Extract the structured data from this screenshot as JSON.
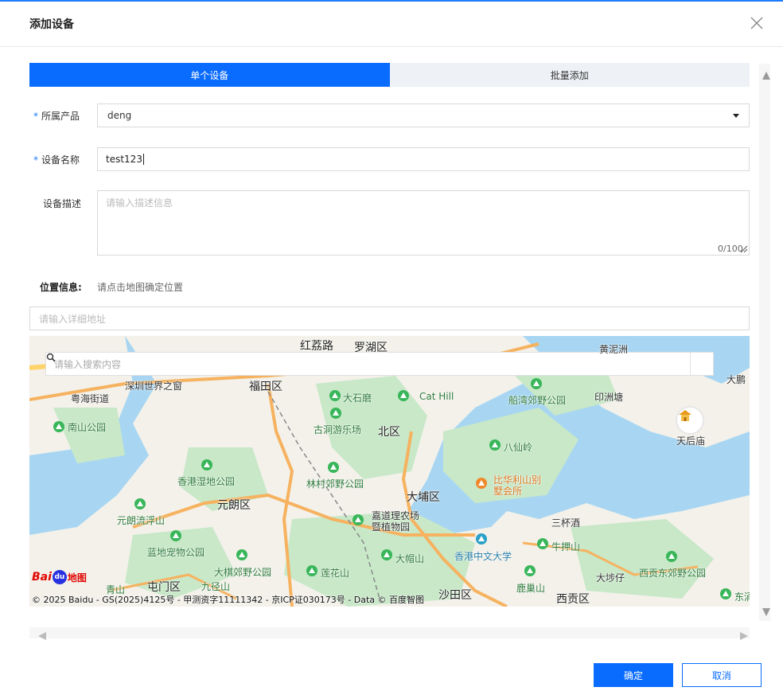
{
  "dialog": {
    "title": "添加设备",
    "close_icon": "close-icon"
  },
  "tabs": [
    {
      "label": "单个设备",
      "active": true
    },
    {
      "label": "批量添加",
      "active": false
    }
  ],
  "form": {
    "product": {
      "label": "所属产品",
      "required_mark": "*",
      "value": "deng"
    },
    "device_name": {
      "label": "设备名称",
      "required_mark": "*",
      "value": "test123"
    },
    "description": {
      "label": "设备描述",
      "placeholder": "请输入描述信息",
      "counter": "0/100"
    },
    "location": {
      "label": "位置信息:",
      "hint": "请点击地图确定位置"
    },
    "address": {
      "placeholder": "请输入详细地址"
    }
  },
  "map": {
    "search_placeholder": "请输入搜索内容",
    "search_icon": "search-icon",
    "labels": {
      "l1": "红荔路",
      "l2": "罗湖区",
      "l3": "福田区",
      "l4": "深圳世界之窗",
      "l5": "粤海街道",
      "l6": "南山公园",
      "l7": "大石磨",
      "l8": "Cat Hill",
      "l9": "船湾郊野公园",
      "l10": "印洲塘",
      "l11": "大鹏",
      "l12": "黄泥洲",
      "l13": "古洞游乐场",
      "l14": "北区",
      "l15": "八仙岭",
      "l16": "天后庙",
      "l17": "香港湿地公园",
      "l18": "林村郊野公园",
      "l19": "比华利山别墅会所",
      "l20": "元朗区",
      "l21": "大埔区",
      "l22": "元朗流浮山",
      "l23": "嘉道理农场暨植物园",
      "l24": "三杯酒",
      "l25": "牛押山",
      "l26": "蓝地宠物公园",
      "l27": "香港中文大学",
      "l28": "大帽山",
      "l29": "大棋郊野公园",
      "l30": "莲花山",
      "l31": "大埗仔",
      "l32": "西贡东郊野公园",
      "l33": "鹿巢山",
      "l34": "青山",
      "l35": "屯门区",
      "l36": "九径山",
      "l37": "沙田区",
      "l38": "西贡区",
      "l39": "东涌"
    },
    "copyright": "© 2025 Baidu - GS(2025)4125号 - 甲测资字11111342 - 京ICP证030173号 - Data © 百度智图",
    "logo": {
      "part1": "Bai",
      "part2": "du",
      "part3": "地图"
    }
  },
  "footer": {
    "ok_label": "确定",
    "cancel_label": "取消"
  },
  "colors": {
    "primary": "#0a6cff",
    "tab_inactive_bg": "#eef1f6",
    "map_water": "#a8d6f2",
    "map_land": "#f3f1ea",
    "map_park": "#c8e8c8",
    "map_road": "#f6b25f"
  }
}
